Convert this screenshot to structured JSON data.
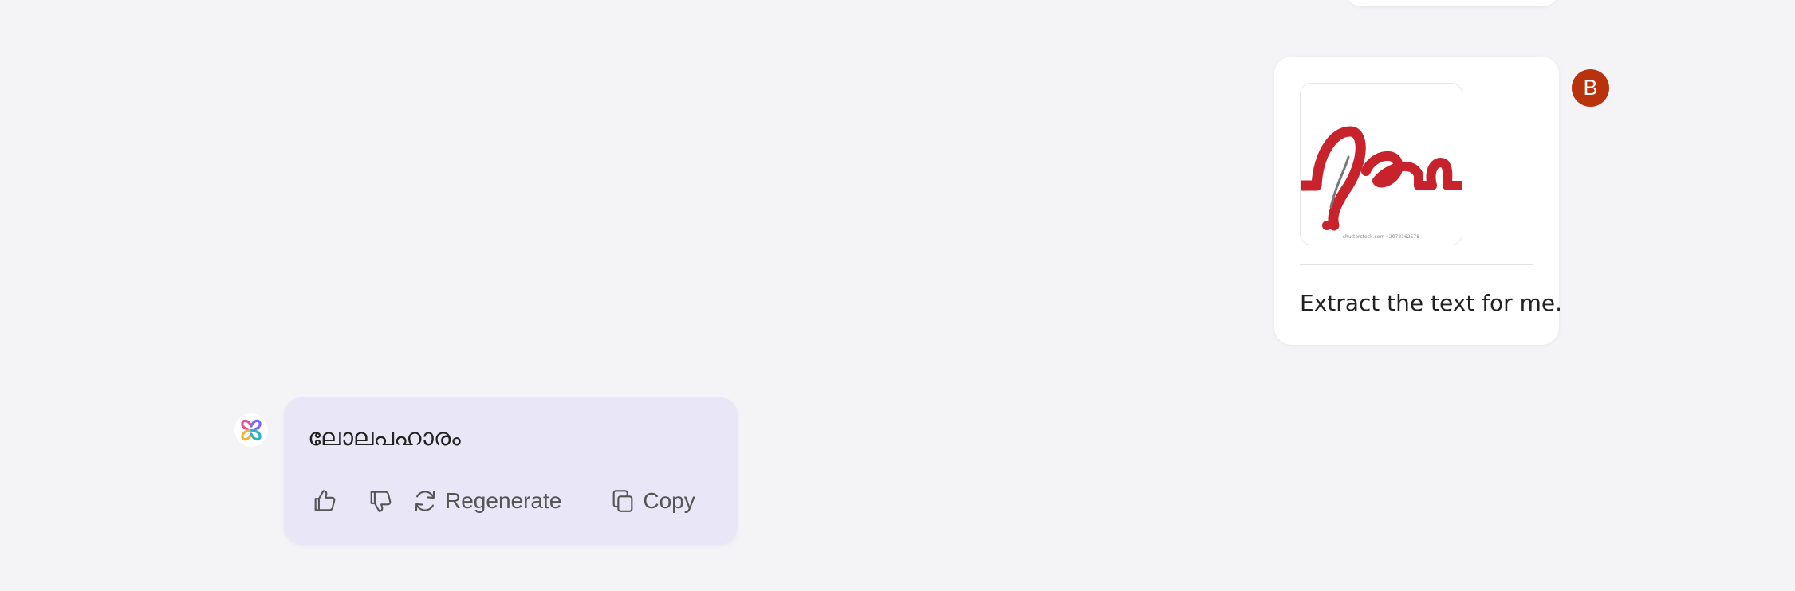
{
  "conversation": {
    "user_message": {
      "prompt": "Extract the text for me.",
      "attachment": {
        "type": "image",
        "depicted_text": "ദോ",
        "watermark": "shutterstock.com · 2072162578"
      },
      "avatar_initial": "B"
    },
    "assistant_message": {
      "response": "ലോലപഹാരം",
      "actions": {
        "like_icon": "thumbs-up-icon",
        "dislike_icon": "thumbs-down-icon",
        "regenerate_label": "Regenerate",
        "copy_label": "Copy"
      }
    }
  },
  "colors": {
    "background": "#f4f3f6",
    "assistant_bubble": "#e9e6f7",
    "avatar": "#b8320d",
    "image_ink": "#c8232c"
  }
}
